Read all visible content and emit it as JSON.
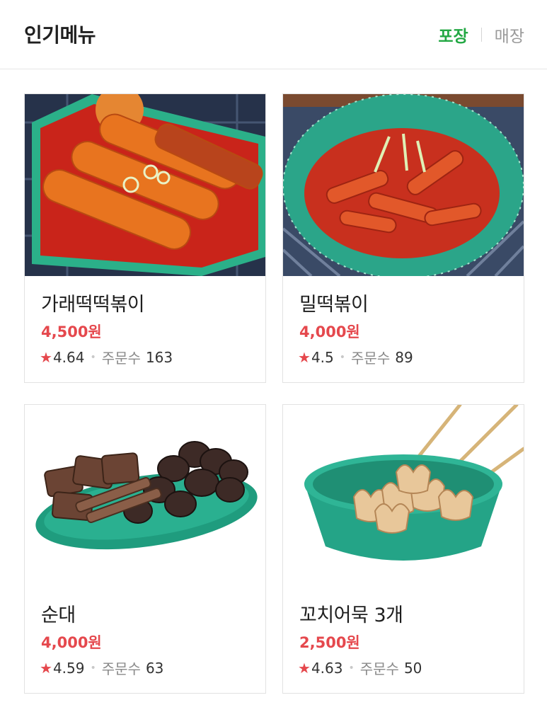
{
  "header": {
    "title": "인기메뉴",
    "tabs": [
      {
        "label": "포장",
        "active": true
      },
      {
        "label": "매장",
        "active": false
      }
    ]
  },
  "colors": {
    "accent_green": "#23a844",
    "price_red": "#e5484d",
    "star_red": "#e5484d"
  },
  "menu": {
    "items": [
      {
        "name": "가래떡떡볶이",
        "price": "4,500원",
        "rating": "4.64",
        "orders_label": "주문수",
        "orders": "163",
        "image": "garaetteok-tteokbokki-photo"
      },
      {
        "name": "밀떡볶이",
        "price": "4,000원",
        "rating": "4.5",
        "orders_label": "주문수",
        "orders": "89",
        "image": "wheat-tteokbokki-bowl-photo"
      },
      {
        "name": "순대",
        "price": "4,000원",
        "rating": "4.59",
        "orders_label": "주문수",
        "orders": "63",
        "image": "sundae-plate-photo"
      },
      {
        "name": "꼬치어묵 3개",
        "price": "2,500원",
        "rating": "4.63",
        "orders_label": "주문수",
        "orders": "50",
        "image": "fishcake-skewers-bowl-photo"
      }
    ]
  },
  "icons": {
    "star": "star-icon"
  }
}
